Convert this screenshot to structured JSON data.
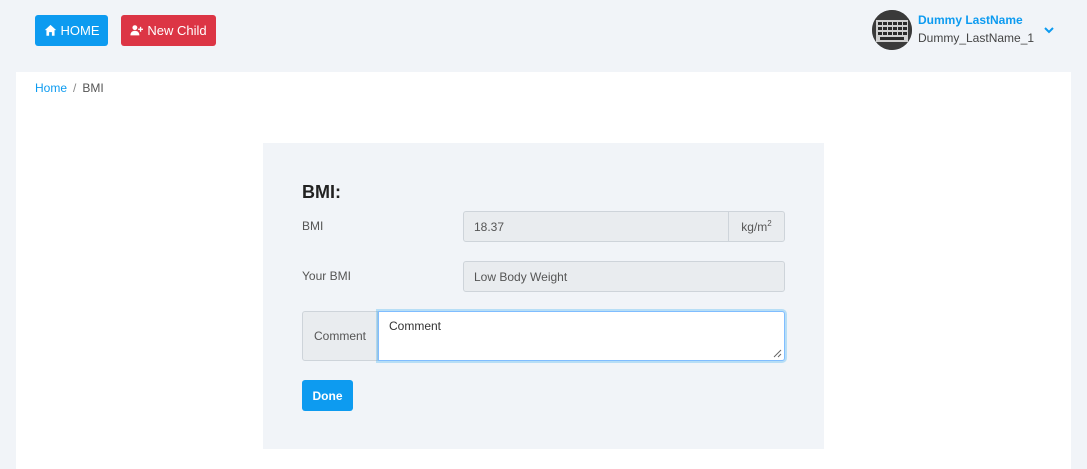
{
  "header": {
    "home_label": "HOME",
    "new_child_label": "New Child",
    "home_icon": "home-icon",
    "new_child_icon": "user-plus-icon"
  },
  "user": {
    "name": "Dummy LastName",
    "username": "Dummy_LastName_1",
    "chevron_icon": "chevron-down-icon"
  },
  "breadcrumb": {
    "home": "Home",
    "separator": "/",
    "current": "BMI"
  },
  "form": {
    "title": "BMI:",
    "bmi_label": "BMI",
    "bmi_value": "18.37",
    "unit_base": "kg/m",
    "unit_exp": "2",
    "your_bmi_label": "Your BMI",
    "your_bmi_value": "Low Body Weight",
    "comment_label": "Comment",
    "comment_value": "Comment",
    "done_label": "Done"
  },
  "colors": {
    "primary": "#0d9bf0",
    "danger": "#dc3545",
    "background": "#f1f4f8"
  }
}
